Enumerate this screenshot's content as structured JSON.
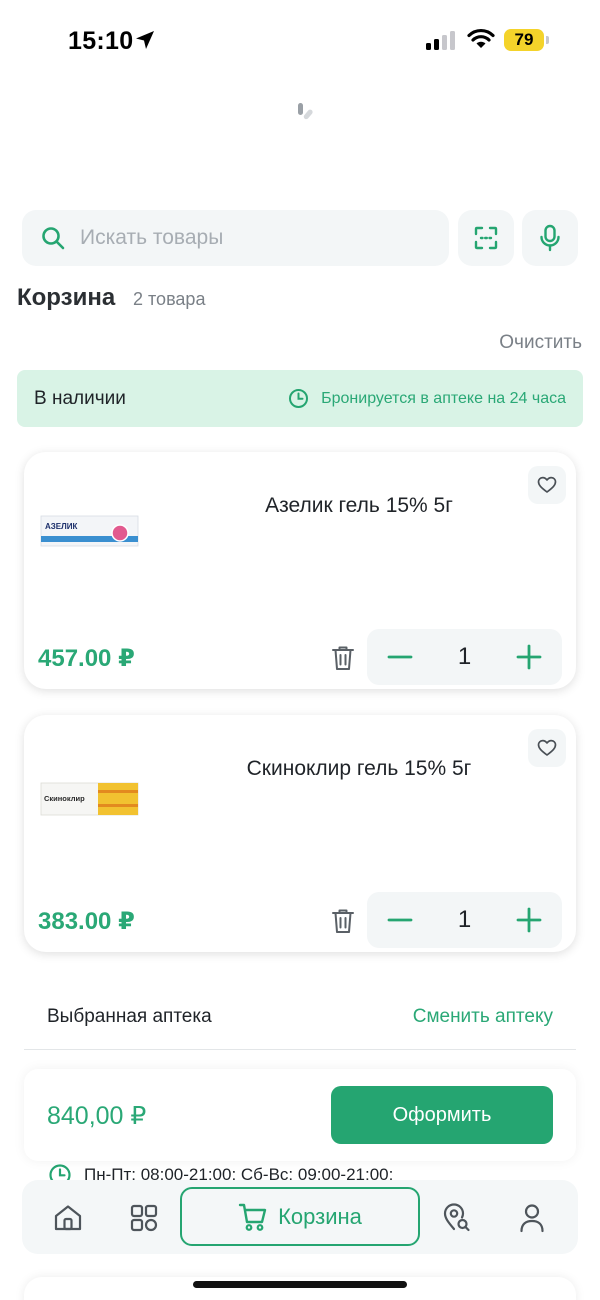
{
  "status_bar": {
    "time": "15:10",
    "battery": "79"
  },
  "search": {
    "placeholder": "Искать товары"
  },
  "cart": {
    "title": "Корзина",
    "count": "2 товара",
    "clear_label": "Очистить"
  },
  "stock_banner": {
    "label": "В наличии",
    "reserve_note": "Бронируется в аптеке на 24 часа"
  },
  "products": [
    {
      "name": "Азелик гель 15% 5г",
      "price": "457.00 ₽",
      "quantity": "1",
      "brand": "АЗЕЛИК"
    },
    {
      "name": "Скиноклир гель 15% 5г",
      "price": "383.00 ₽",
      "quantity": "1",
      "brand": "Скиноклир"
    }
  ],
  "stepper": {
    "minus": "−",
    "plus": "+"
  },
  "pharmacy": {
    "label": "Выбранная аптека",
    "change_label": "Сменить аптеку",
    "hours": "Пн-Пт: 08:00-21:00; Сб-Вс: 09:00-21:00;"
  },
  "checkout": {
    "total": "840,00 ₽",
    "button_label": "Оформить"
  },
  "bottom_nav": {
    "cart_label": "Корзина"
  },
  "colors": {
    "accent": "#25a571",
    "accent_light": "#d9f3e6",
    "surface": "#f3f6f7"
  },
  "icons": [
    "location-arrow-icon",
    "search-icon",
    "scan-icon",
    "microphone-icon",
    "clock-icon",
    "heart-icon",
    "trash-icon",
    "home-icon",
    "catalog-icon",
    "cart-icon",
    "pharmacy-map-icon",
    "profile-icon"
  ]
}
